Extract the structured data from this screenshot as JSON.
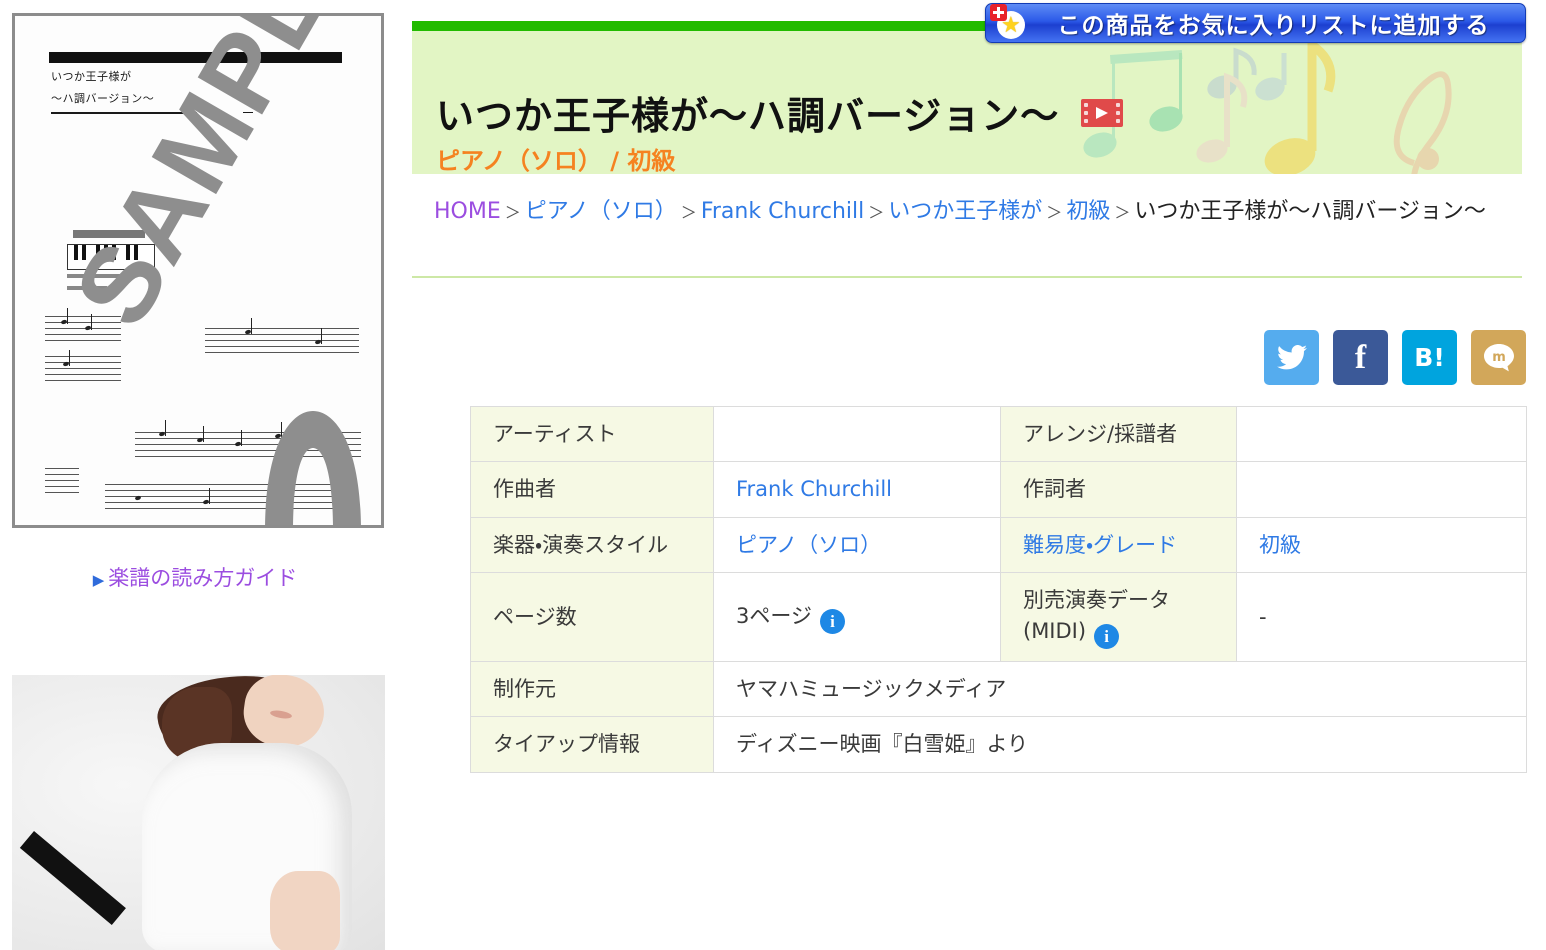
{
  "favorite_button": {
    "label": "この商品をお気に入りリストに追加する",
    "icon": "star-plus-icon",
    "bg_color": "#2b59e8"
  },
  "header": {
    "accent_bar_color": "#22bb00",
    "band_color": "#e2f5c4",
    "title": "いつか王子様が〜ハ調バージョン〜",
    "video_icon": "video-play-icon",
    "subtitle": "ピアノ（ソロ） / 初級",
    "subtitle_color": "#f58220"
  },
  "breadcrumb": {
    "items": [
      {
        "label": "HOME",
        "type": "home"
      },
      {
        "label": "ピアノ（ソロ）",
        "type": "link"
      },
      {
        "label": "Frank Churchill",
        "type": "link"
      },
      {
        "label": "いつか王子様が",
        "type": "link"
      },
      {
        "label": "初級",
        "type": "link"
      },
      {
        "label": "いつか王子様が〜ハ調バージョン〜",
        "type": "current"
      }
    ],
    "separator": "＞"
  },
  "social": [
    {
      "name": "twitter",
      "glyph": "🐦",
      "color": "#55acee",
      "label": ""
    },
    {
      "name": "facebook",
      "glyph": "f",
      "color": "#3b5998",
      "label": "f"
    },
    {
      "name": "hatena-bookmark",
      "glyph": "B!",
      "color": "#00a4de",
      "label": "B!"
    },
    {
      "name": "mixi",
      "glyph": "m",
      "color": "#d2a75a",
      "label": "m"
    }
  ],
  "info_table": {
    "rows": [
      {
        "label1": "アーティスト",
        "label1_link": false,
        "value1": "",
        "value1_link": false,
        "label2": "アレンジ/採譜者",
        "label2_link": false,
        "value2": "",
        "value2_link": false
      },
      {
        "label1": "作曲者",
        "label1_link": false,
        "value1": "Frank Churchill",
        "value1_link": true,
        "label2": "作詞者",
        "label2_link": false,
        "value2": "",
        "value2_link": false
      },
      {
        "label1": "楽器・演奏スタイル",
        "label1_link": false,
        "value1": "ピアノ（ソロ）",
        "value1_link": true,
        "label2": "難易度・グレード",
        "label2_link": true,
        "value2": "初級",
        "value2_link": true
      },
      {
        "label1": "ページ数",
        "label1_link": false,
        "label1_info": false,
        "value1": "3ページ",
        "value1_link": false,
        "value1_info": true,
        "label2": "別売演奏データ(MIDI)",
        "label2_link": false,
        "label2_info": true,
        "value2": "-",
        "value2_link": false
      },
      {
        "label1": "制作元",
        "label1_link": false,
        "value1": "ヤマハミュージックメディア",
        "value1_link": false,
        "label2": "",
        "label2_link": false,
        "value2": "",
        "value2_link": false,
        "span": true
      },
      {
        "label1": "タイアップ情報",
        "label1_link": false,
        "value1": "ディズニー映画『白雪姫』より",
        "value1_link": false,
        "label2": "",
        "label2_link": false,
        "value2": "",
        "value2_link": false,
        "span": true
      }
    ]
  },
  "sidebar": {
    "score_thumbnail": {
      "watermark": "SAMPLE",
      "sheet_title_line1": "いつか王子様が",
      "sheet_title_line2": "〜ハ調バージョン〜"
    },
    "guide_link": {
      "label": "楽譜の読み方ガイド",
      "bullet": "▶",
      "color": "#9b4de0"
    },
    "ad_image_alt": "白いTシャツを着た人物の写真"
  }
}
